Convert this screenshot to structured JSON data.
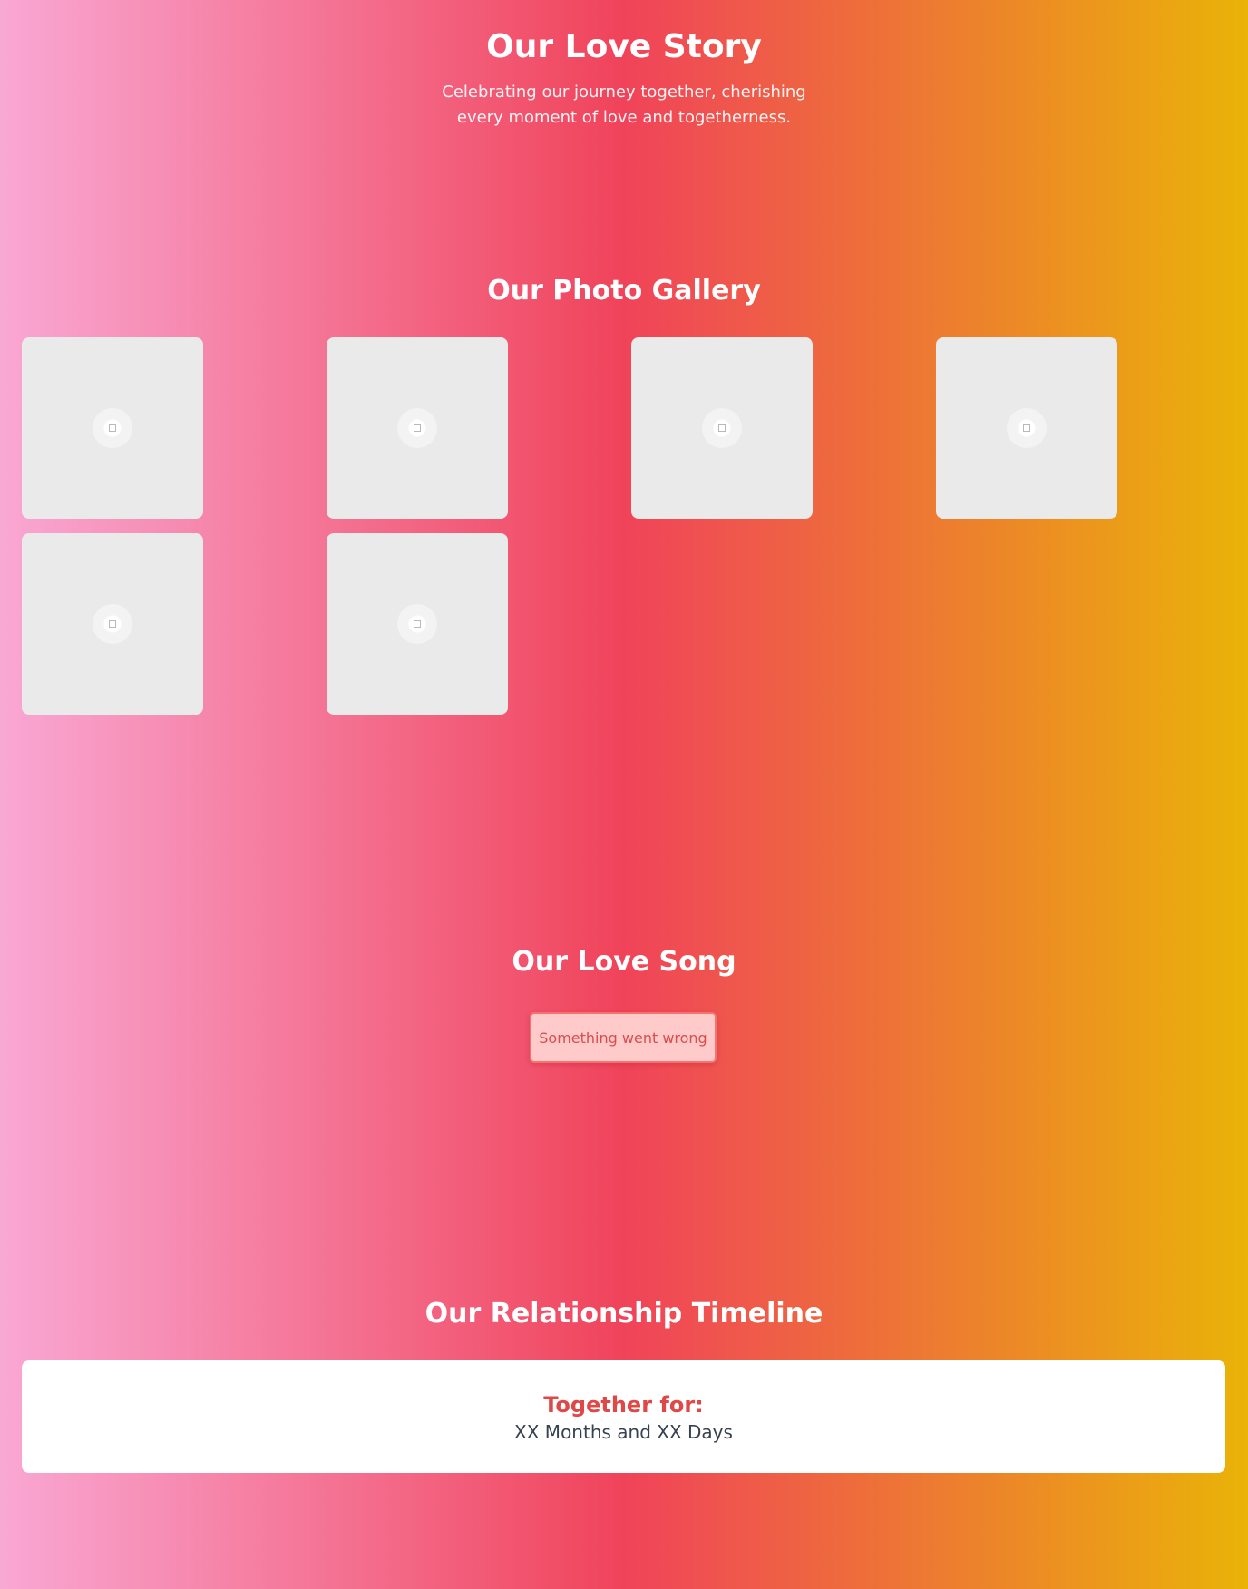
{
  "header": {
    "title": "Our Love Story",
    "tagline": "Celebrating our journey together, cherishing every moment of love and togetherness."
  },
  "gallery": {
    "title": "Our Photo Gallery",
    "photo_count": 6
  },
  "song": {
    "title": "Our Love Song",
    "error_message": "Something went wrong"
  },
  "timeline": {
    "title": "Our Relationship Timeline",
    "label": "Together for:",
    "duration": "XX Months and XX Days"
  },
  "colors": {
    "gradient_start": "#f9a8d4",
    "gradient_mid": "#f0435a",
    "gradient_end": "#eab308",
    "accent_red": "#e04848",
    "error_bg": "#fecaca"
  },
  "icons": {
    "photo_placeholder": "image-icon"
  }
}
